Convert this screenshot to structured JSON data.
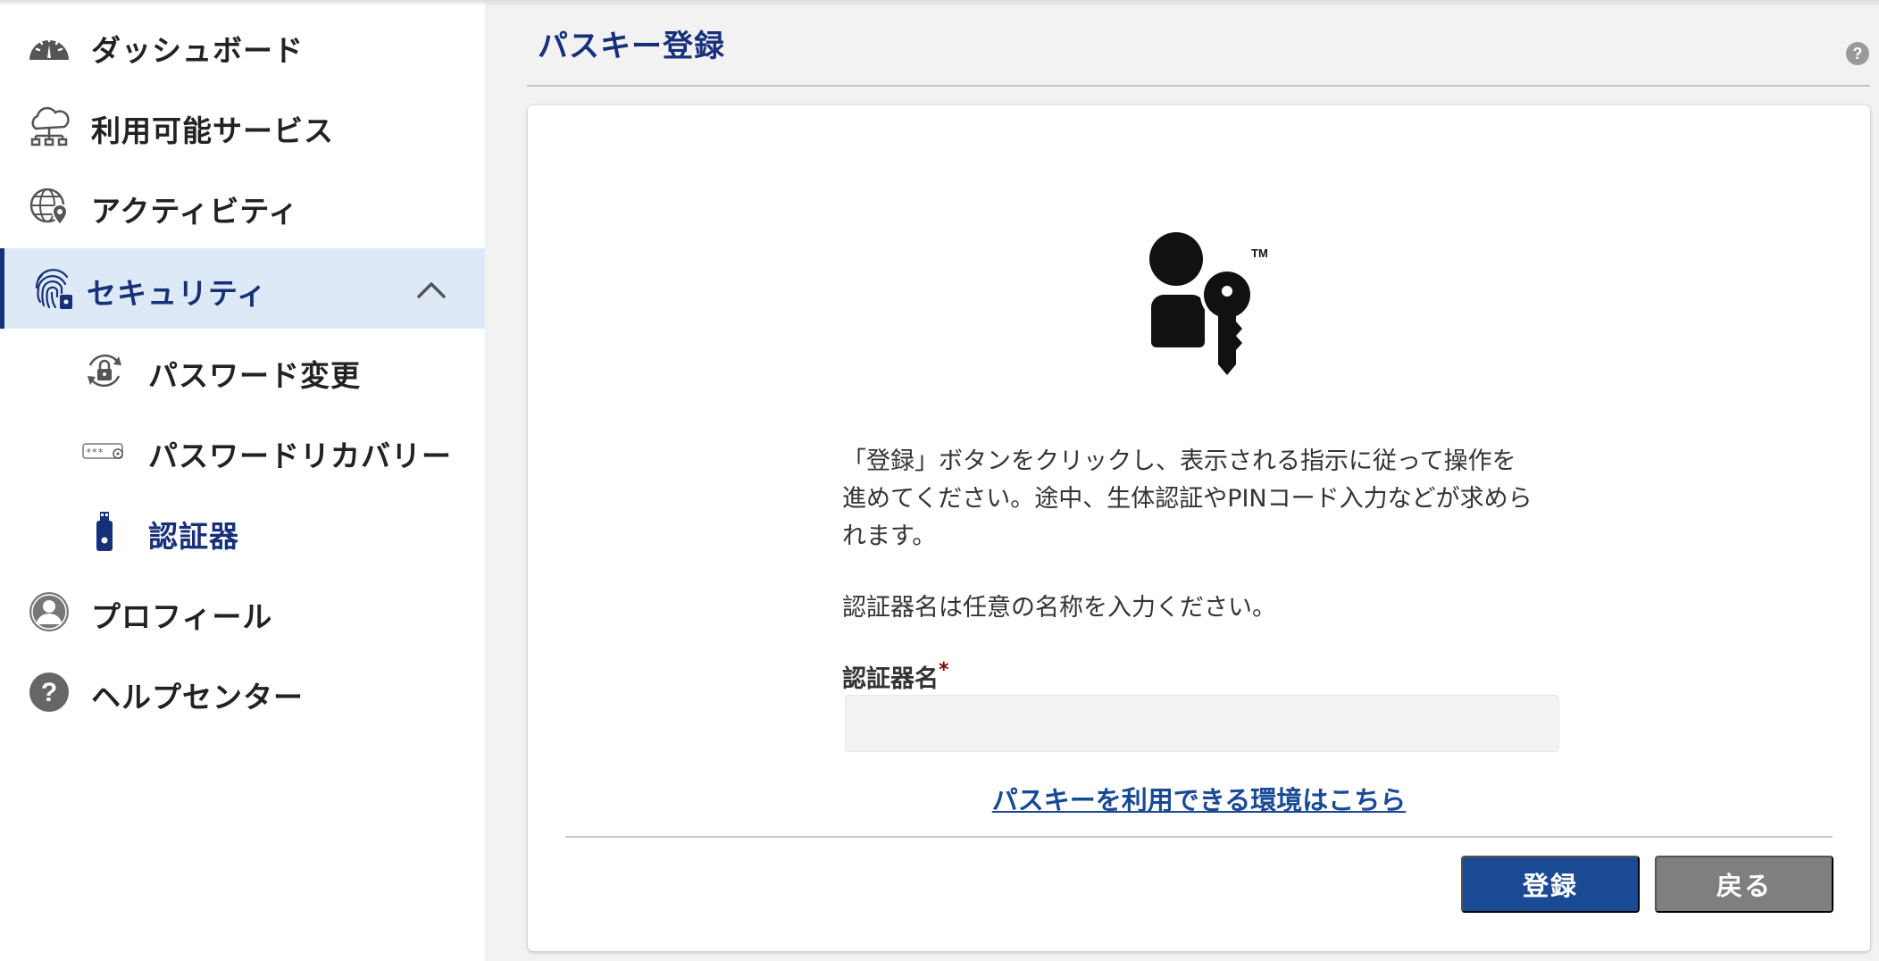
{
  "sidebar": {
    "items": [
      {
        "label": "ダッシュボード",
        "icon": "dashboard-gauge-icon"
      },
      {
        "label": "利用可能サービス",
        "icon": "cloud-network-icon"
      },
      {
        "label": "アクティビティ",
        "icon": "globe-location-icon"
      },
      {
        "label": "セキュリティ",
        "icon": "fingerprint-lock-icon",
        "expanded": true
      },
      {
        "label": "プロフィール",
        "icon": "user-circle-icon"
      },
      {
        "label": "ヘルプセンター",
        "icon": "help-circle-icon"
      }
    ],
    "security_subitems": [
      {
        "label": "パスワード変更",
        "icon": "lock-refresh-icon"
      },
      {
        "label": "パスワードリカバリー",
        "icon": "password-field-icon"
      },
      {
        "label": "認証器",
        "icon": "security-key-icon",
        "current": true
      }
    ]
  },
  "page": {
    "title": "パスキー登録"
  },
  "card": {
    "hero_icon": "passkey-user-key-icon",
    "trademark": "TM",
    "instruction_lines": [
      "「登録」ボタンをクリックし、表示される指示に従って操作を",
      "進めてください。途中、生体認証やPINコード入力などが求めら",
      "れます。"
    ],
    "instruction2": "認証器名は任意の名称を入力ください。",
    "field_label": "認証器名",
    "required_mark": "*",
    "field_value": "",
    "env_link": "パスキーを利用できる環境はこちら",
    "register_button": "登録",
    "back_button": "戻る"
  },
  "colors": {
    "brand": "#17307a",
    "primary_button": "#1b4a94",
    "secondary_button": "#7f7f7f",
    "active_nav_bg": "#dde9f6"
  }
}
